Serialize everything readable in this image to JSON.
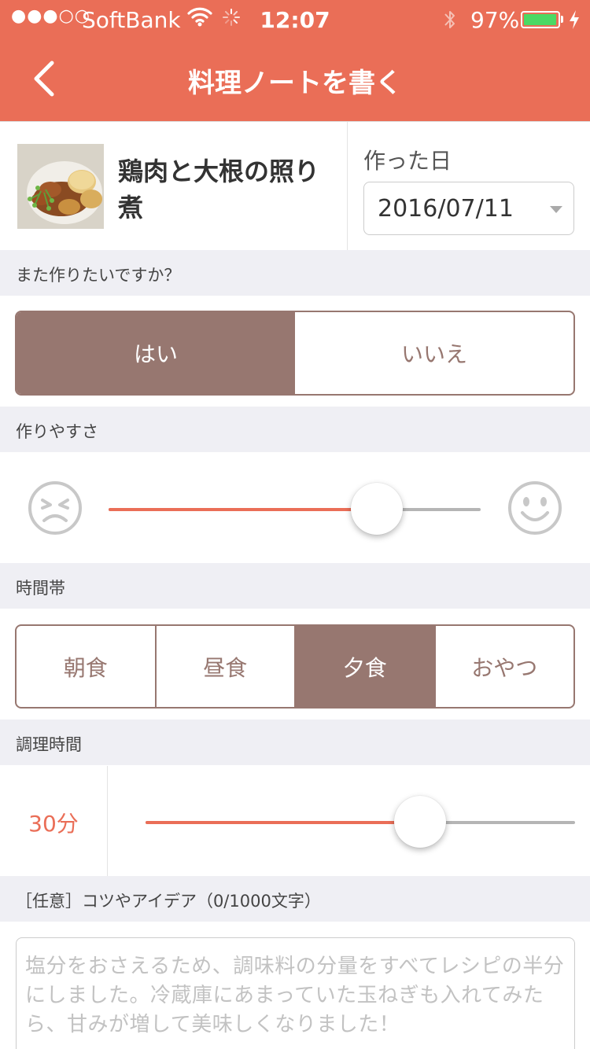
{
  "status_bar": {
    "signal": "●●●○○",
    "carrier": "SoftBank",
    "time": "12:07",
    "battery_percent": "97%",
    "battery_level": 0.97,
    "wifi_icon": "wifi-icon",
    "activity_icon": "activity-spinner-icon",
    "bluetooth_icon": "bluetooth-icon",
    "charging_icon": "charging-bolt-icon"
  },
  "header": {
    "title": "料理ノートを書く",
    "back_icon": "chevron-left-icon"
  },
  "recipe": {
    "name": "鶏肉と大根の照り煮",
    "date_label": "作った日",
    "date_value": "2016/07/11"
  },
  "again": {
    "label": "また作りたいですか？",
    "options": [
      "はい",
      "いいえ"
    ],
    "selected": "はい"
  },
  "ease": {
    "label": "作りやすさ",
    "level": 0.72,
    "low_icon": "unhappy-face-icon",
    "high_icon": "smiley-face-icon"
  },
  "timeslot": {
    "label": "時間帯",
    "options": [
      "朝食",
      "昼食",
      "夕食",
      "おやつ"
    ],
    "selected": "夕食"
  },
  "cook_time": {
    "label": "調理時間",
    "value": "30分",
    "level": 0.64
  },
  "note": {
    "label": "［任意］コツやアイデア（0/1000文字）",
    "placeholder": "塩分をおさえるため、調味料の分量をすべてレシピの半分にしました。冷蔵庫にあまっていた玉ねぎも入れてみたら、甘みが増して美味しくなりました！"
  },
  "colors": {
    "accent": "#EA6E57",
    "selected": "#977770",
    "section_bg": "#EFEFF4",
    "battery": "#4CD964"
  }
}
